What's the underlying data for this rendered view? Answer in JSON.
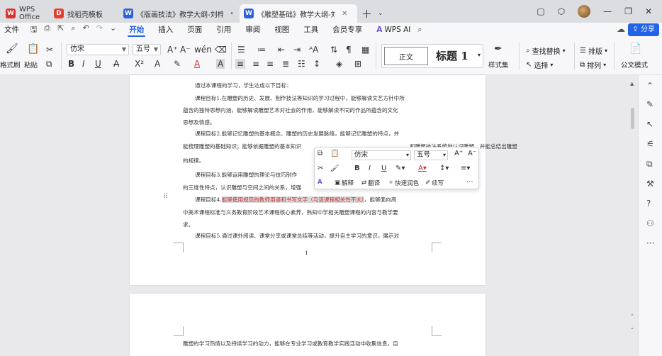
{
  "tabs": [
    {
      "label": "WPS Office",
      "icon": "wps-logo-icon",
      "color": "#d9312b"
    },
    {
      "label": "找稻壳模板",
      "icon": "docer-icon",
      "color": "#e5402f"
    },
    {
      "label": "《版画技法》教学大纲-刘梓会.doc",
      "icon": "word-doc-icon",
      "color": "#2b62d9"
    },
    {
      "label": "《雕塑基础》教学大纲-刘梓会",
      "icon": "word-doc-icon",
      "color": "#2b62d9"
    }
  ],
  "menubar": {
    "file": "文件",
    "items": [
      "开始",
      "插入",
      "页面",
      "引用",
      "审阅",
      "视图",
      "工具",
      "会员专享"
    ],
    "wps_ai": "WPS AI",
    "share": "分享"
  },
  "ribbon": {
    "format_painter": "格式刷",
    "paste": "粘贴",
    "font": "仿宋",
    "size": "五号",
    "style_normal": "正文",
    "style_h1": "标题 1",
    "style_set": "样式集",
    "find_replace": "查找替换",
    "select": "选择",
    "layout": "排版",
    "sort": "排列",
    "formula_mode": "公文模式"
  },
  "document": {
    "lines": [
      "通过本课程的学习，学生达成以下目标：",
      "课程目标1.在雕塑的历史、发展、制作技法等知识的学习过程中，能够解读文艺方针中所",
      "蕴含的独特思想内涵，能够解读雕塑艺术对社会的作用，能够解读不同的作品所蕴含的文化",
      "思想及情感。",
      "课程目标2.能够记忆雕塑的基本概念、雕塑的历史发展脉络，能够记忆雕塑的特点，并",
      "能梳理雕塑的基础知识；能够依据雕塑的基本知识",
      "和雕塑技法系统地认识雕塑，并能总结出雕塑",
      "的规律。",
      "课程目标3.能够运用雕塑的理论与技巧制作",
      "的三维性特点，认识雕塑与空间之间的关系，增强",
      "课程目标4.",
      "能够使用规范的教师用语和书写文字（与该课程相关性不大）",
      "，能够面向高",
      "中美术课程标准与义务教育阶段艺术课程核心素养，熟知中学相关雕塑课程的内容与教学要",
      "求。",
      "课程目标5.通过课外阅读、课堂分享或课堂总结等活动，提升自主学习的意识，展示对"
    ],
    "page_number": "1",
    "page2_line": "雕塑的学习热情以及持续学习的动力，能够在专业学习或教育教学实践活动中收集信息，自"
  },
  "float_toolbar": {
    "font": "仿宋",
    "size": "五号",
    "explain": "解释",
    "translate": "翻译",
    "polish": "快速润色",
    "continue": "续写"
  }
}
